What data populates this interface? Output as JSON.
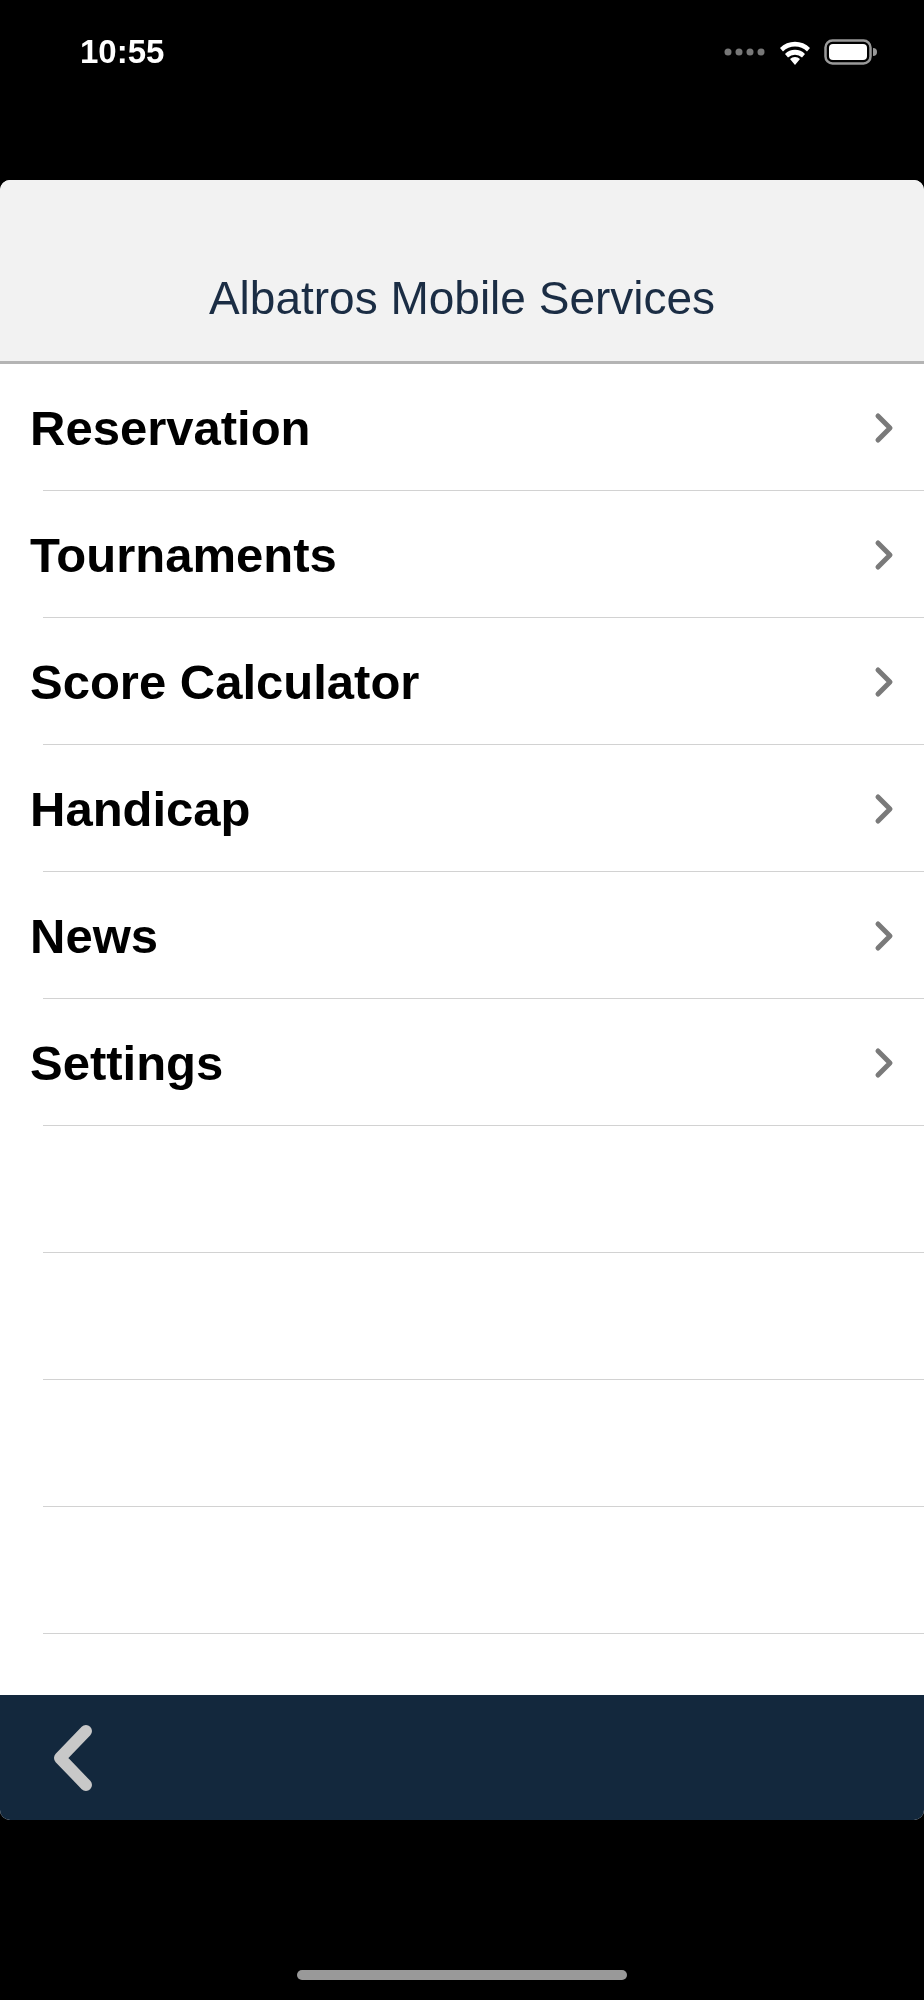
{
  "status_bar": {
    "time": "10:55"
  },
  "header": {
    "title": "Albatros Mobile Services"
  },
  "menu": {
    "items": [
      {
        "label": "Reservation"
      },
      {
        "label": "Tournaments"
      },
      {
        "label": "Score Calculator"
      },
      {
        "label": "Handicap"
      },
      {
        "label": "News"
      },
      {
        "label": "Settings"
      }
    ]
  }
}
